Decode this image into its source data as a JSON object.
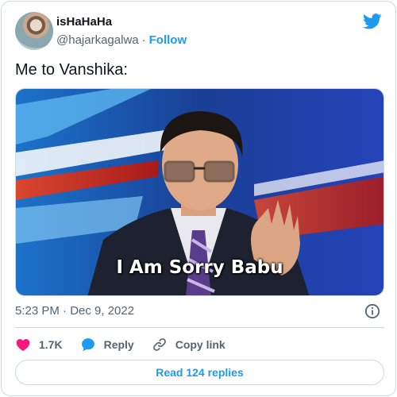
{
  "author": {
    "display_name": "isHaHaHa",
    "handle": "@hajarkagalwa",
    "follow_label": "Follow",
    "avatar_icon": "profile-photo"
  },
  "tweet": {
    "text": "Me to Vanshika:",
    "media_caption": "I Am Sorry Babu",
    "timestamp": "5:23 PM · Dec 9, 2022"
  },
  "actions": {
    "like_count": "1.7K",
    "reply_label": "Reply",
    "copy_link_label": "Copy link"
  },
  "read_replies_label": "Read 124 replies",
  "colors": {
    "accent": "#1d9bf0",
    "like": "#f91880",
    "secondary_text": "#536471",
    "border": "#cfd9de"
  },
  "icons": [
    "twitter-bird-icon",
    "info-icon",
    "heart-icon",
    "reply-bubble-icon",
    "link-icon"
  ]
}
